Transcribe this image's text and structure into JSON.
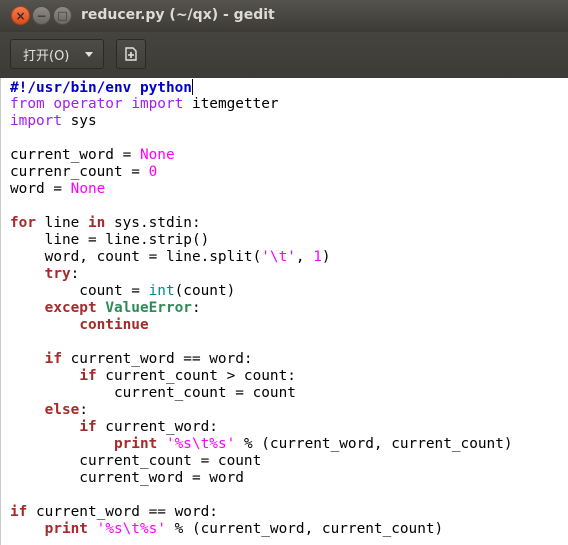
{
  "window": {
    "title": "reducer.py (~/qx) - gedit",
    "close_glyph": "×",
    "minimize_glyph": "−",
    "maximize_glyph": "□"
  },
  "toolbar": {
    "open_label": "打开(O)",
    "new_icon": "new-document-icon"
  },
  "editor": {
    "language": "python",
    "lines": [
      [
        [
          "she",
          "#!/usr/bin/env python"
        ]
      ],
      [
        [
          "imp",
          "from"
        ],
        [
          "",
          " "
        ],
        [
          "imp",
          "operator"
        ],
        [
          "",
          " "
        ],
        [
          "imp",
          "import"
        ],
        [
          "",
          " itemgetter"
        ]
      ],
      [
        [
          "imp",
          "import"
        ],
        [
          "",
          " sys"
        ]
      ],
      [],
      [
        [
          "",
          "current_word = "
        ],
        [
          "con",
          "None"
        ]
      ],
      [
        [
          "",
          "currenr_count = "
        ],
        [
          "con",
          "0"
        ]
      ],
      [
        [
          "",
          "word = "
        ],
        [
          "con",
          "None"
        ]
      ],
      [],
      [
        [
          "kw",
          "for"
        ],
        [
          "",
          " line "
        ],
        [
          "kw",
          "in"
        ],
        [
          "",
          " sys.stdin:"
        ]
      ],
      [
        [
          "",
          "    line = line.strip()"
        ]
      ],
      [
        [
          "",
          "    word, count = line.split("
        ],
        [
          "str",
          "'\\t'"
        ],
        [
          "",
          ", "
        ],
        [
          "con",
          "1"
        ],
        [
          "",
          ")"
        ]
      ],
      [
        [
          "",
          "    "
        ],
        [
          "kw",
          "try"
        ],
        [
          "",
          ":"
        ]
      ],
      [
        [
          "",
          "        count = "
        ],
        [
          "bi",
          "int"
        ],
        [
          "",
          "(count)"
        ]
      ],
      [
        [
          "",
          "    "
        ],
        [
          "kw",
          "except"
        ],
        [
          "",
          " "
        ],
        [
          "exc",
          "ValueError"
        ],
        [
          "",
          ":"
        ]
      ],
      [
        [
          "",
          "        "
        ],
        [
          "kw",
          "continue"
        ]
      ],
      [],
      [
        [
          "",
          "    "
        ],
        [
          "kw",
          "if"
        ],
        [
          "",
          " current_word == word:"
        ]
      ],
      [
        [
          "",
          "        "
        ],
        [
          "kw",
          "if"
        ],
        [
          "",
          " current_count > count:"
        ]
      ],
      [
        [
          "",
          "            current_count = count"
        ]
      ],
      [
        [
          "",
          "    "
        ],
        [
          "kw",
          "else"
        ],
        [
          "",
          ":"
        ]
      ],
      [
        [
          "",
          "        "
        ],
        [
          "kw",
          "if"
        ],
        [
          "",
          " current_word:"
        ]
      ],
      [
        [
          "",
          "            "
        ],
        [
          "kw",
          "print"
        ],
        [
          "",
          " "
        ],
        [
          "str",
          "'%s\\t%s'"
        ],
        [
          "",
          " % (current_word, current_count)"
        ]
      ],
      [
        [
          "",
          "        current_count = count"
        ]
      ],
      [
        [
          "",
          "        current_word = word"
        ]
      ],
      [],
      [
        [
          "kw",
          "if"
        ],
        [
          "",
          " current_word == word:"
        ]
      ],
      [
        [
          "",
          "    "
        ],
        [
          "kw",
          "print"
        ],
        [
          "",
          " "
        ],
        [
          "str",
          "'%s\\t%s'"
        ],
        [
          "",
          " % (current_word, current_count)"
        ]
      ]
    ]
  }
}
